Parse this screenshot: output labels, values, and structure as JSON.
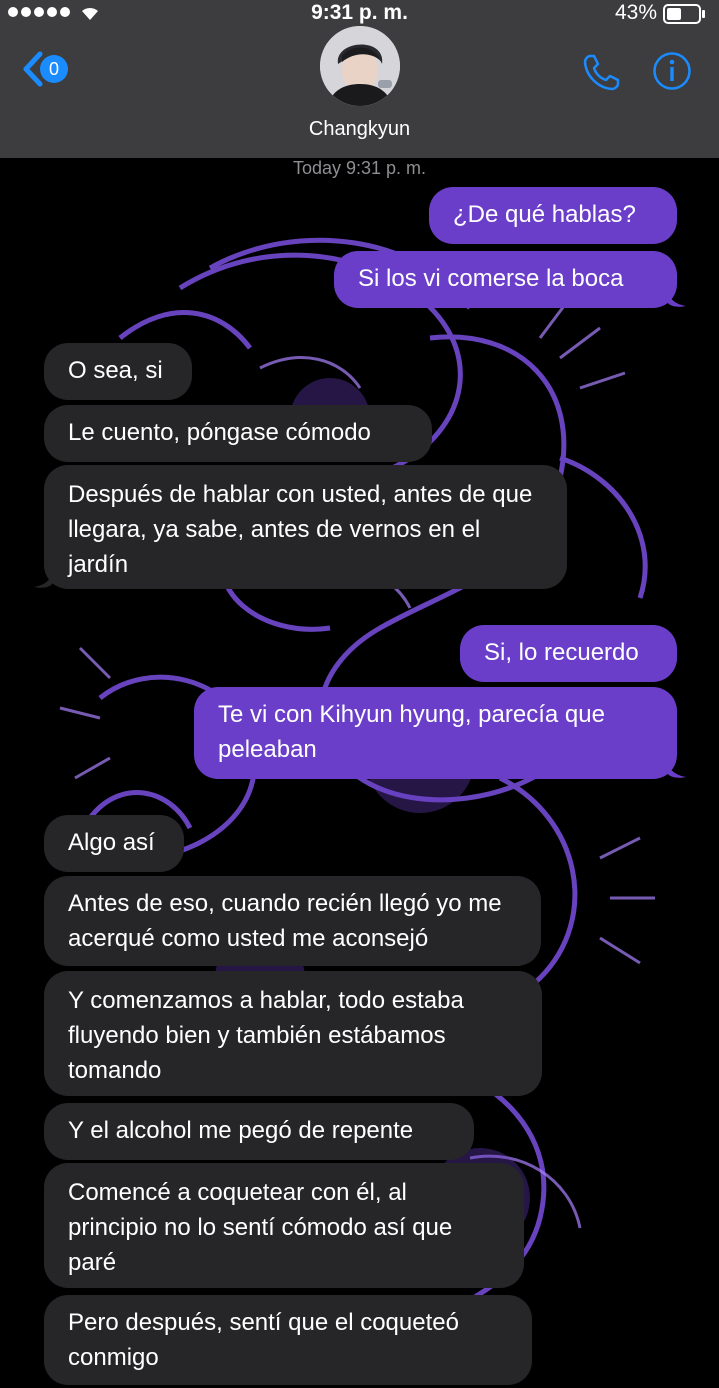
{
  "status_bar": {
    "time": "9:31 p. m.",
    "battery": "43%"
  },
  "header": {
    "back_badge": "0",
    "contact_name": "Changkyun",
    "icons": {
      "back": "chevron-left-icon",
      "call": "phone-icon",
      "info": "info-icon"
    },
    "accent_color": "#1a8cff"
  },
  "thread": {
    "timestamp": "Today 9:31 p. m.",
    "sent_color": "#6a3ec9",
    "received_color": "#262628"
  },
  "messages": [
    {
      "from": "me",
      "text": "¿De qué hablas?"
    },
    {
      "from": "me",
      "text": "Si los vi comerse la boca"
    },
    {
      "from": "them",
      "text": "O sea, si"
    },
    {
      "from": "them",
      "text": "Le cuento, póngase cómodo"
    },
    {
      "from": "them",
      "text": "Después de hablar con usted, antes de que llegara, ya sabe, antes de vernos en el jardín"
    },
    {
      "from": "me",
      "text": "Si, lo recuerdo"
    },
    {
      "from": "me",
      "text": "Te vi con Kihyun hyung, parecía que peleaban"
    },
    {
      "from": "them",
      "text": "Algo así"
    },
    {
      "from": "them",
      "text": "Antes de eso, cuando recién llegó yo me acerqué como usted me aconsejó"
    },
    {
      "from": "them",
      "text": "Y comenzamos a hablar, todo estaba fluyendo bien y también estábamos tomando"
    },
    {
      "from": "them",
      "text": "Y el alcohol me pegó de repente"
    },
    {
      "from": "them",
      "text": "Comencé a coquetear con él, al principio no lo sentí cómodo así que paré"
    },
    {
      "from": "them",
      "text": "Pero después, sentí que el coqueteó conmigo"
    }
  ]
}
